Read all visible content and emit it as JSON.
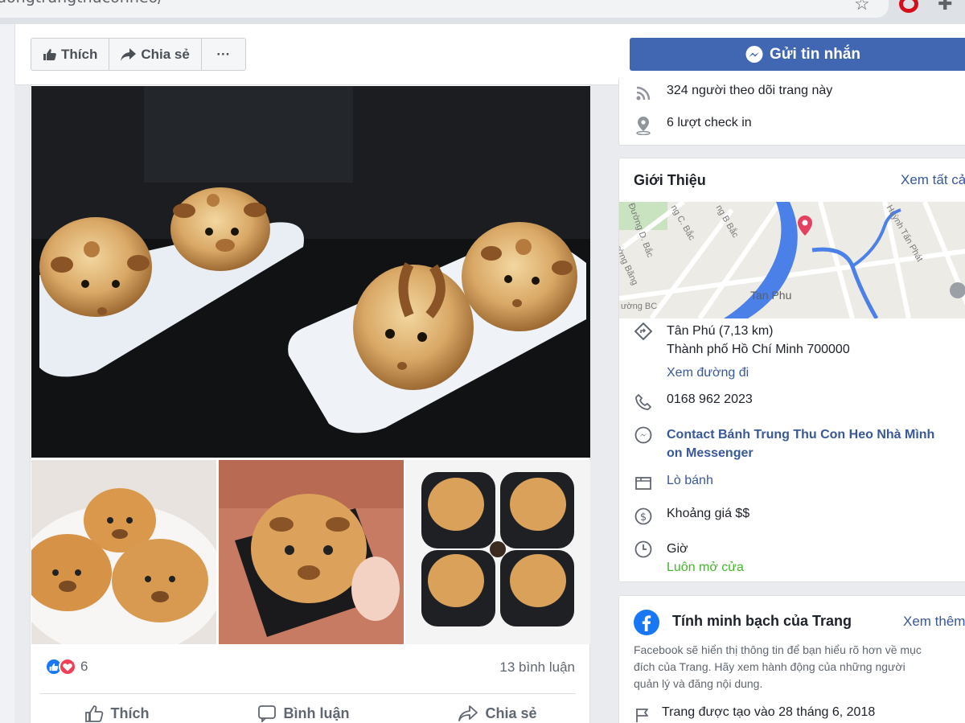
{
  "browser": {
    "url": "uongtrungthuconheo/",
    "star_icon": "star-icon",
    "opera_icon": "opera-icon",
    "extensions_icon": "puzzle-icon"
  },
  "page_actions": {
    "like_label": "Thích",
    "share_label": "Chia sẻ",
    "more_label": "···",
    "message_label": "Gửi tin nhắn"
  },
  "post": {
    "reaction_count": "6",
    "comments_label": "13 bình luận",
    "actions": {
      "like": "Thích",
      "comment": "Bình luận",
      "share": "Chia sẻ"
    }
  },
  "stats": {
    "followers": "324 người theo dõi trang này",
    "checkins": "6 lượt check in"
  },
  "about": {
    "title": "Giới Thiệu",
    "see_all": "Xem tất cả",
    "map": {
      "district_label": "Tan Phu",
      "street_labels": [
        "Đường D. Bắc",
        "ng C. Bắc",
        "ng B Bắc",
        "Huỳnh Tấn Phát",
        "ường Băng",
        "ường BC"
      ]
    },
    "address_line1": "Tân Phú (7,13 km)",
    "address_line2": "Thành phố Hồ Chí Minh 700000",
    "directions": "Xem đường đi",
    "phone": "0168 962 2023",
    "messenger_line1": "Contact Bánh Trung Thu Con Heo Nhà Mình",
    "messenger_line2": "on Messenger",
    "category": "Lò bánh",
    "price": "Khoảng giá $$",
    "hours_label": "Giờ",
    "hours_status": "Luôn mở cửa"
  },
  "transparency": {
    "title": "Tính minh bạch của Trang",
    "see_more": "Xem thêm",
    "desc_line1": "Facebook sẽ hiển thị thông tin để bạn hiểu rõ hơn về mục",
    "desc_line2": "đích của Trang. Hãy xem hành động của những người",
    "desc_line3": "quản lý và đăng nội dung.",
    "created": "Trang được tạo vào 28 tháng 6, 2018"
  },
  "colors": {
    "facebook_blue": "#4267b2",
    "link": "#385898",
    "open_green": "#42b72a",
    "map_pin": "#e4405f",
    "river": "#4a80e8"
  }
}
